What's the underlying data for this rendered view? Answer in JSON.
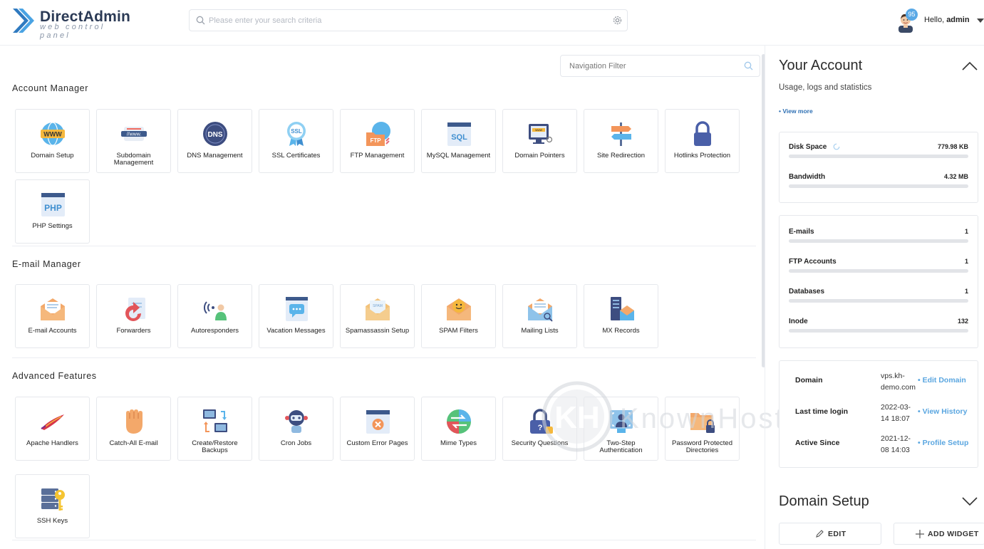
{
  "logo": {
    "brand": "DirectAdmin",
    "subtitle": "web control panel"
  },
  "search": {
    "placeholder": "Please enter your search criteria"
  },
  "user": {
    "greeting_prefix": "Hello,",
    "username": "admin",
    "notification_count": "95"
  },
  "nav_filter": {
    "placeholder": "Navigation Filter"
  },
  "sections": [
    {
      "title": "Account Manager",
      "items": [
        {
          "label": "Domain Setup",
          "icon": "globe-www-icon"
        },
        {
          "label": "Subdomain Management",
          "icon": "subdomain-icon"
        },
        {
          "label": "DNS Management",
          "icon": "dns-globe-icon"
        },
        {
          "label": "SSL Certificates",
          "icon": "ssl-badge-icon"
        },
        {
          "label": "FTP Management",
          "icon": "ftp-folder-icon"
        },
        {
          "label": "MySQL Management",
          "icon": "sql-window-icon"
        },
        {
          "label": "Domain Pointers",
          "icon": "monitor-www-icon"
        },
        {
          "label": "Site Redirection",
          "icon": "signpost-icon"
        },
        {
          "label": "Hotlinks Protection",
          "icon": "padlock-icon"
        },
        {
          "label": "PHP Settings",
          "icon": "php-window-icon"
        }
      ]
    },
    {
      "title": "E-mail Manager",
      "items": [
        {
          "label": "E-mail Accounts",
          "icon": "envelope-icon"
        },
        {
          "label": "Forwarders",
          "icon": "forward-arrow-icon"
        },
        {
          "label": "Autoresponders",
          "icon": "signal-person-icon"
        },
        {
          "label": "Vacation Messages",
          "icon": "chat-window-icon"
        },
        {
          "label": "Spamassassin Setup",
          "icon": "spam-envelope-icon"
        },
        {
          "label": "SPAM Filters",
          "icon": "filter-envelope-icon"
        },
        {
          "label": "Mailing Lists",
          "icon": "list-envelope-icon"
        },
        {
          "label": "MX Records",
          "icon": "server-mail-icon"
        }
      ]
    },
    {
      "title": "Advanced Features",
      "items": [
        {
          "label": "Apache Handlers",
          "icon": "apache-feather-icon"
        },
        {
          "label": "Catch-All E-mail",
          "icon": "hand-catch-icon"
        },
        {
          "label": "Create/Restore Backups",
          "icon": "backup-monitors-icon"
        },
        {
          "label": "Cron Jobs",
          "icon": "robot-icon"
        },
        {
          "label": "Custom Error Pages",
          "icon": "error-window-icon"
        },
        {
          "label": "Mime Types",
          "icon": "mime-arrows-icon"
        },
        {
          "label": "Security Questions",
          "icon": "question-lock-icon"
        },
        {
          "label": "Two-Step Authentication",
          "icon": "face-scan-icon"
        },
        {
          "label": "Password Protected Directories",
          "icon": "locked-folder-icon"
        },
        {
          "label": "SSH Keys",
          "icon": "server-key-icon"
        }
      ]
    }
  ],
  "account": {
    "title": "Your Account",
    "subtitle": "Usage, logs and statistics",
    "view_more": "• View more",
    "usage": [
      {
        "name": "Disk Space",
        "value": "779.98 KB",
        "fill_percent": 0
      },
      {
        "name": "Bandwidth",
        "value": "4.32 MB",
        "fill_percent": 0
      }
    ],
    "counts": [
      {
        "name": "E-mails",
        "value": "1",
        "fill_percent": 0
      },
      {
        "name": "FTP Accounts",
        "value": "1",
        "fill_percent": 0
      },
      {
        "name": "Databases",
        "value": "1",
        "fill_percent": 0
      },
      {
        "name": "Inode",
        "value": "132",
        "fill_percent": 0
      }
    ],
    "info": [
      {
        "key": "Domain",
        "value": "vps.kh-demo.com",
        "action": "• Edit Domain"
      },
      {
        "key": "Last time login",
        "value": "2022-03-14 18:07",
        "action": "• View History"
      },
      {
        "key": "Active Since",
        "value": "2021-12-08 14:03",
        "action": "• Profile Setup"
      }
    ]
  },
  "domain_setup_widget": {
    "title": "Domain Setup",
    "edit_label": "EDIT",
    "add_widget_label": "ADD WIDGET"
  },
  "watermark": {
    "text": "KnownHost"
  },
  "colors": {
    "accent_blue": "#2d6fb3",
    "link_blue": "#5aa6e0",
    "badge_blue": "#5aa9e6",
    "brand_dark": "#2b3a55"
  }
}
